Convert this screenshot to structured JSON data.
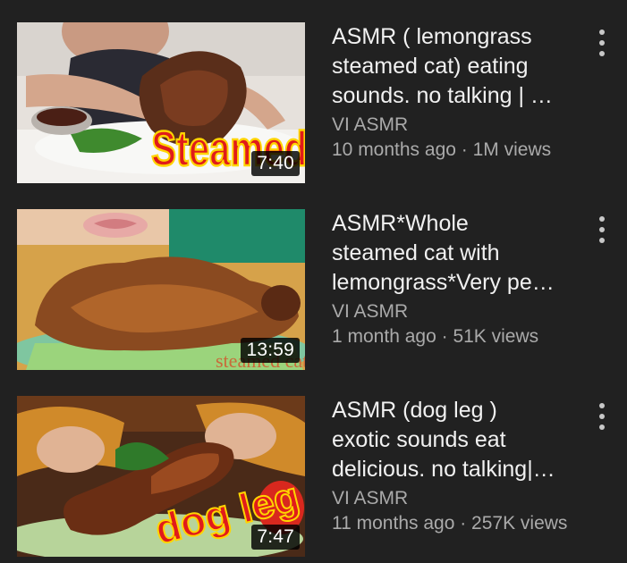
{
  "videos": [
    {
      "title_lines": [
        "ASMR ( lemongrass",
        "steamed cat) eating",
        "sounds. no talking | …"
      ],
      "channel": "VI ASMR",
      "age": "10 months ago",
      "views": "1M views",
      "duration": "7:40",
      "overlay_text": "Steamed cat"
    },
    {
      "title_lines": [
        "ASMR*Whole",
        "steamed cat with",
        "lemongrass*Very pe…"
      ],
      "channel": "VI ASMR",
      "age": "1 month ago",
      "views": "51K views",
      "duration": "13:59",
      "overlay_text": "steamed cat"
    },
    {
      "title_lines": [
        "ASMR  (dog leg )",
        "exotic sounds eat",
        "delicious. no talking|…"
      ],
      "channel": "VI ASMR",
      "age": "11 months ago",
      "views": "257K views",
      "duration": "7:47",
      "overlay_text": "dog leg"
    }
  ],
  "separator": " · ",
  "icons": {
    "more": "more-vert-icon"
  },
  "colors": {
    "background": "#212121",
    "title": "#f1f1f1",
    "secondary": "#aaaaaa",
    "overlay_red": "#e01b1b",
    "overlay_yellow": "#ffd400"
  }
}
